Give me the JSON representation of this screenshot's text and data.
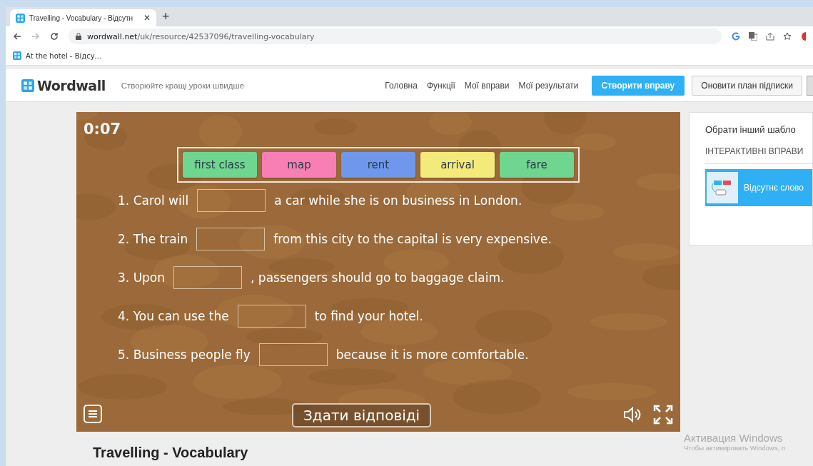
{
  "browser": {
    "tabs": [
      {
        "title": "Travelling - Vocabulary - Відсутн",
        "selected": true,
        "close": "✕"
      }
    ],
    "new_tab": "+",
    "url_host": "wordwall.net",
    "url_path": "/uk/resource/42537096/travelling-vocabulary",
    "bookmarks": [
      "At the hotel - Відсу..."
    ]
  },
  "header": {
    "logo": "Wordwall",
    "tagline": "Створюйте кращі уроки швидше",
    "nav": [
      "Головна",
      "Функції",
      "Мої вправи",
      "Мої результати"
    ],
    "create_button": "Створити вправу",
    "upgrade_button": "Оновити план підписки"
  },
  "game": {
    "timer": "0:07",
    "words": [
      {
        "text": "first class",
        "color": "#6fd68f"
      },
      {
        "text": "map",
        "color": "#f77fb4"
      },
      {
        "text": "rent",
        "color": "#6f98ec"
      },
      {
        "text": "arrival",
        "color": "#f4ea7c"
      },
      {
        "text": "fare",
        "color": "#6fd68f"
      }
    ],
    "sentences": [
      {
        "number": "1.",
        "before": "Carol will",
        "after": "a car while she is on business in London."
      },
      {
        "number": "2.",
        "before": "The train",
        "after": "from this city to the capital is very expensive."
      },
      {
        "number": "3.",
        "before": "Upon",
        "after": ", passengers should go to baggage claim."
      },
      {
        "number": "4.",
        "before": "You can use the",
        "after": "to find your hotel."
      },
      {
        "number": "5.",
        "before": "Business people fly",
        "after": "because it is more comfortable."
      }
    ],
    "submit_button": "Здати відповіді"
  },
  "sidebar": {
    "title": "Обрати інший шабло",
    "section": "ІНТЕРАКТИВНІ ВПРАВИ",
    "templates": [
      {
        "label": "Відсутнє слово",
        "selected": true
      }
    ]
  },
  "activity_title": "Travelling - Vocabulary",
  "os_overlay": {
    "title": "Активация Windows",
    "subtitle": "Чтобы активировать Windows, п"
  }
}
